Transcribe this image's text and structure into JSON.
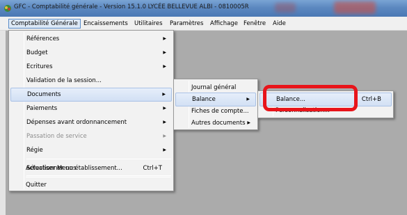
{
  "window": {
    "title": "GFC - Comptabilité générale - Version 15.1.0   LYCÉE BELLEVUE ALBI - 0810005R"
  },
  "menubar": {
    "items": [
      "Comptabilité Générale",
      "Encaissements",
      "Utilitaires",
      "Paramètres",
      "Affichage",
      "Fenêtre",
      "Aide"
    ]
  },
  "main_menu": {
    "items": [
      {
        "label": "Références",
        "submenu": true
      },
      {
        "label": "Budget",
        "submenu": true
      },
      {
        "label": "Ecritures",
        "submenu": true
      },
      {
        "label": "Validation de la session..."
      },
      {
        "label": "Documents",
        "submenu": true,
        "highlighted": true
      },
      {
        "label": "Paiements",
        "submenu": true
      },
      {
        "label": "Dépenses avant ordonnancement",
        "submenu": true
      },
      {
        "label": "Passation de service",
        "submenu": true,
        "disabled": true
      },
      {
        "label": "Régie",
        "submenu": true
      },
      {
        "label": "Sélectionner un établissement...",
        "shortcut": "Ctrl+T"
      },
      {
        "label": "Actualiser Menus"
      },
      {
        "label": "Quitter"
      }
    ]
  },
  "documents_menu": {
    "items": [
      {
        "label": "Journal général"
      },
      {
        "label": "Balance",
        "submenu": true,
        "highlighted": true
      },
      {
        "label": "Fiches de compte..."
      },
      {
        "label": "Autres documents",
        "submenu": true
      }
    ]
  },
  "balance_menu": {
    "items": [
      {
        "label": "Balance...",
        "shortcut": "Ctrl+B",
        "highlighted": true
      },
      {
        "label": "Personnalisation..."
      }
    ]
  },
  "annotation": {
    "color": "#e8141a"
  }
}
